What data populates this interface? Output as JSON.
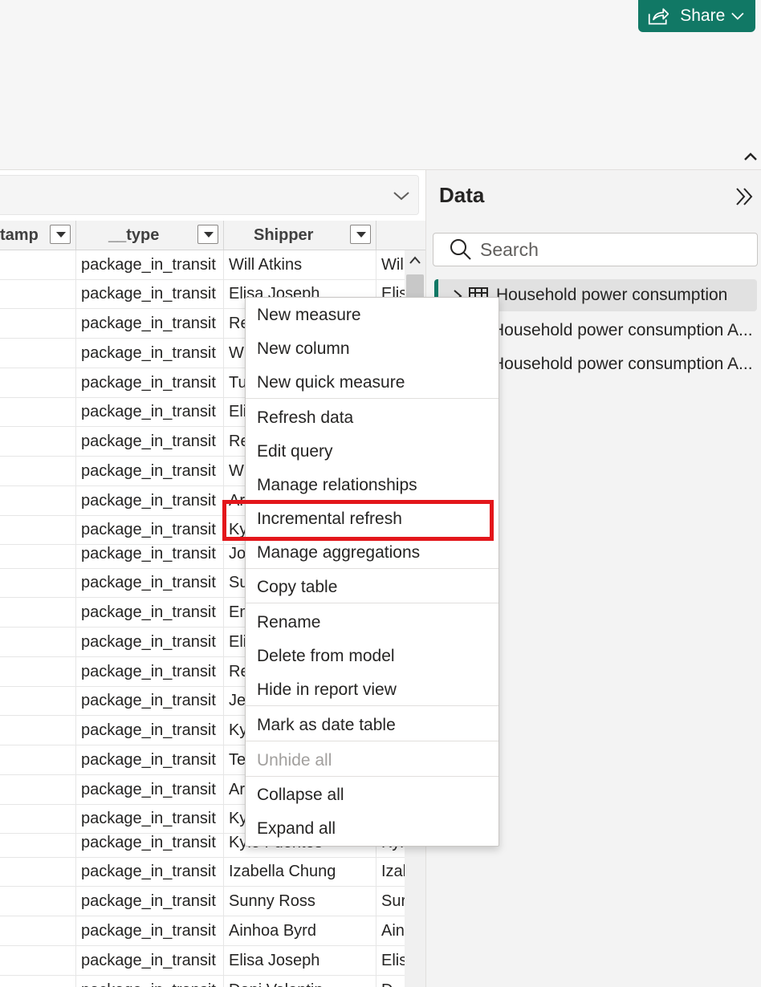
{
  "ribbon": {
    "share_label": "Share"
  },
  "table": {
    "columns": [
      {
        "label": "tamp"
      },
      {
        "label": "__type"
      },
      {
        "label": "Shipper"
      },
      {
        "label": ""
      }
    ],
    "rows": [
      [
        "",
        "package_in_transit",
        "Will Atkins",
        "Wil"
      ],
      [
        "",
        "package_in_transit",
        "Elisa Joseph",
        "Elis"
      ],
      [
        "",
        "package_in_transit",
        "Re",
        ""
      ],
      [
        "",
        "package_in_transit",
        "W",
        ""
      ],
      [
        "",
        "package_in_transit",
        "Tu",
        ""
      ],
      [
        "",
        "package_in_transit",
        "Eli",
        ""
      ],
      [
        "",
        "package_in_transit",
        "Re",
        ""
      ],
      [
        "",
        "package_in_transit",
        "W",
        ""
      ],
      [
        "",
        "package_in_transit",
        "Ar",
        ""
      ],
      [
        "",
        "package_in_transit",
        "Ky",
        ""
      ],
      [
        "",
        "package_in_transit",
        "Jo",
        ""
      ],
      [
        "",
        "package_in_transit",
        "Su",
        ""
      ],
      [
        "",
        "package_in_transit",
        "Em",
        ""
      ],
      [
        "",
        "package_in_transit",
        "Eli",
        ""
      ],
      [
        "",
        "package_in_transit",
        "Re",
        ""
      ],
      [
        "",
        "package_in_transit",
        "Je",
        ""
      ],
      [
        "",
        "package_in_transit",
        "Ky",
        ""
      ],
      [
        "",
        "package_in_transit",
        "Te",
        ""
      ],
      [
        "",
        "package_in_transit",
        "Ar",
        ""
      ],
      [
        "",
        "package_in_transit",
        "Ky",
        ""
      ],
      [
        "",
        "package_in_transit",
        "Kyle Fuentes",
        "Kyl"
      ],
      [
        "",
        "package_in_transit",
        "Izabella Chung",
        "Izal"
      ],
      [
        "",
        "package_in_transit",
        "Sunny Ross",
        "Sur"
      ],
      [
        "",
        "package_in_transit",
        "Ainhoa Byrd",
        "Ain"
      ],
      [
        "",
        "package_in_transit",
        "Elisa Joseph",
        "Elis"
      ],
      [
        "",
        "package_in_transit",
        "Dani Valentin",
        "D"
      ]
    ]
  },
  "data_pane": {
    "title": "Data",
    "search_placeholder": "Search",
    "tables": [
      {
        "label": "Household power consumption"
      },
      {
        "label": "Household power consumption A..."
      },
      {
        "label": "Household power consumption A..."
      }
    ]
  },
  "context_menu": {
    "items": [
      {
        "label": "New measure",
        "disabled": false
      },
      {
        "label": "New column",
        "disabled": false
      },
      {
        "label": "New quick measure",
        "disabled": false
      },
      {
        "label": "Refresh data",
        "disabled": false
      },
      {
        "label": "Edit query",
        "disabled": false
      },
      {
        "label": "Manage relationships",
        "disabled": false
      },
      {
        "label": "Incremental refresh",
        "disabled": false
      },
      {
        "label": "Manage aggregations",
        "disabled": false
      },
      {
        "label": "Copy table",
        "disabled": false
      },
      {
        "label": "Rename",
        "disabled": false
      },
      {
        "label": "Delete from model",
        "disabled": false
      },
      {
        "label": "Hide in report view",
        "disabled": false
      },
      {
        "label": "Mark as date table",
        "disabled": false
      },
      {
        "label": "Unhide all",
        "disabled": true
      },
      {
        "label": "Collapse all",
        "disabled": false
      },
      {
        "label": "Expand all",
        "disabled": false
      }
    ],
    "highlighted_item": "Incremental refresh"
  },
  "colors": {
    "accent": "#117865",
    "highlight_box": "#e3161b"
  }
}
